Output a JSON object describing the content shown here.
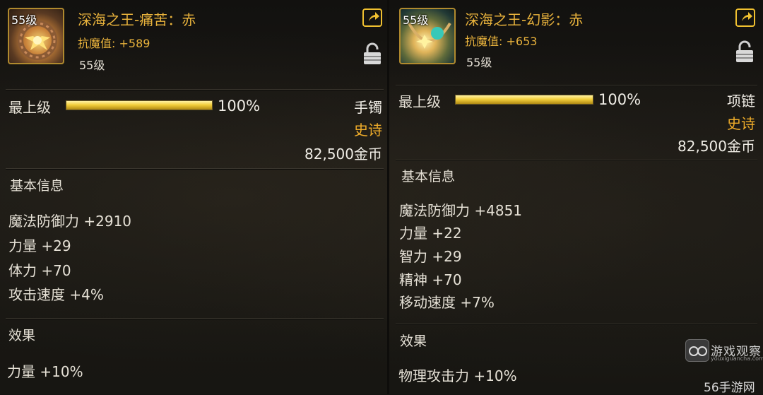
{
  "left": {
    "icon_level": "55级",
    "name": "深海之王-痛苦：赤",
    "resist_label": "抗魔值:",
    "resist_value": "+589",
    "level_text": "55级",
    "max_label": "最上级",
    "progress_pct": "100%",
    "progress": 1.0,
    "slot": "手镯",
    "rarity": "史诗",
    "price": "82,500金币",
    "section_basic": "基本信息",
    "stats": [
      "魔法防御力 +2910",
      "力量 +29",
      "体力 +70",
      "攻击速度 +4%"
    ],
    "section_effect": "效果",
    "effect": "力量 +10%"
  },
  "right": {
    "icon_level": "55级",
    "name": "深海之王-幻影：赤",
    "resist_label": "抗魔值:",
    "resist_value": "+653",
    "level_text": "55级",
    "max_label": "最上级",
    "progress_pct": "100%",
    "progress": 1.0,
    "slot": "项链",
    "rarity": "史诗",
    "price": "82,500金币",
    "section_basic": "基本信息",
    "stats": [
      "魔法防御力 +4851",
      "力量 +22",
      "智力 +29",
      "精神 +70",
      "移动速度 +7%"
    ],
    "section_effect": "效果",
    "effect": "物理攻击力 +10%"
  },
  "watermark": {
    "brand": "游戏观察",
    "brand_sub": "youxiguancha.com",
    "site": "56手游网"
  },
  "colors": {
    "gold_title": "#e8b23c",
    "epic": "#f0ad2a",
    "bar_fill": "#f3cf3c"
  },
  "icons": [
    "share-icon",
    "lock-icon",
    "item-icon"
  ]
}
